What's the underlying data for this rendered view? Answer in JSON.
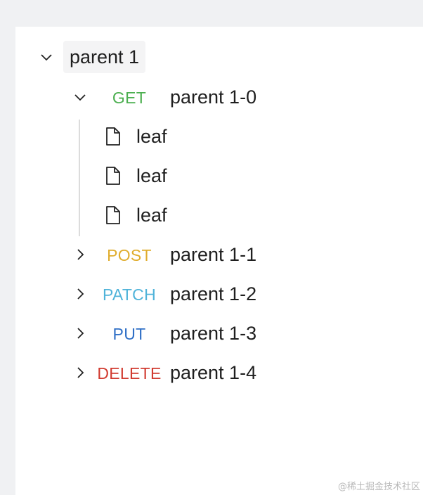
{
  "tree": {
    "root": {
      "title": "parent 1",
      "expanded": true
    },
    "children": [
      {
        "method": "GET",
        "method_color": "#4caf50",
        "title": "parent 1-0",
        "expanded": true,
        "leaves": [
          "leaf",
          "leaf",
          "leaf"
        ]
      },
      {
        "method": "POST",
        "method_color": "#e0ad2e",
        "title": "parent 1-1",
        "expanded": false
      },
      {
        "method": "PATCH",
        "method_color": "#4fb3d9",
        "title": "parent 1-2",
        "expanded": false
      },
      {
        "method": "PUT",
        "method_color": "#2f6fc6",
        "title": "parent 1-3",
        "expanded": false
      },
      {
        "method": "DELETE",
        "method_color": "#d13a2f",
        "title": "parent 1-4",
        "expanded": false
      }
    ]
  },
  "icons": {
    "expanded": "chevron-down-icon",
    "collapsed": "chevron-right-icon",
    "leaf": "file-icon"
  },
  "watermark": "@稀土掘金技术社区"
}
